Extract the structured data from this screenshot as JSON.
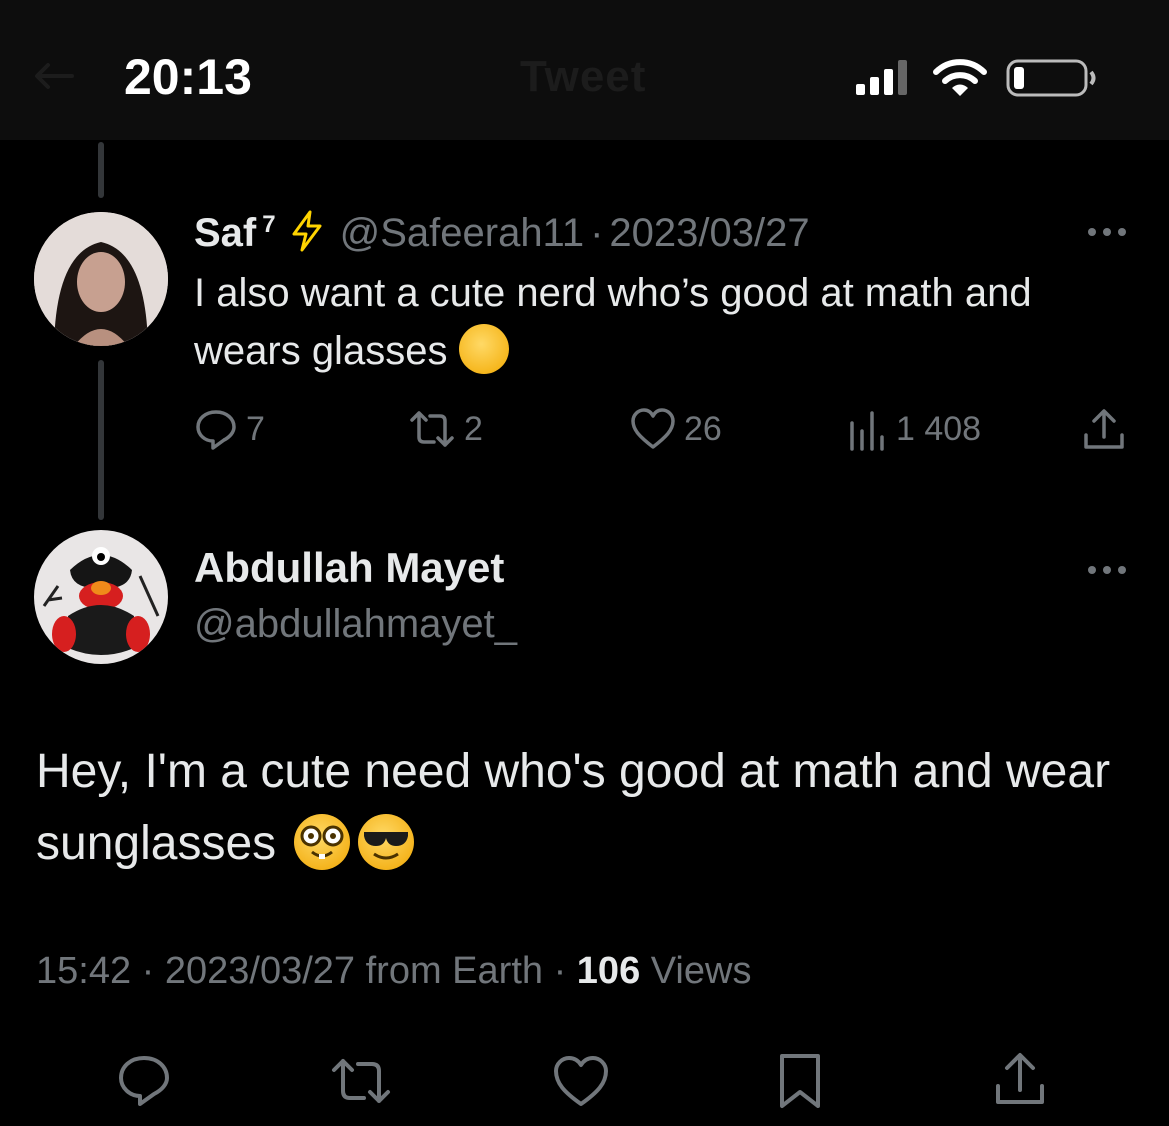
{
  "status_bar": {
    "time": "20:13",
    "header_title": "Tweet"
  },
  "parent_tweet": {
    "author_name": "Saf",
    "author_name_sup": "7",
    "author_handle": "@Safeerah11",
    "separator": "·",
    "date": "2023/03/27",
    "text": "I also want a cute nerd who’s good at math and wears glasses",
    "emoji_icon": "hand-over-mouth-emoji",
    "replies": "7",
    "retweets": "2",
    "likes": "26",
    "views": "1 408"
  },
  "main_tweet": {
    "author_name": "Abdullah Mayet",
    "author_handle": "@abdullahmayet_",
    "text": "Hey, I'm a cute need who's good at math and wear sunglasses",
    "emoji_icons": [
      "nerd-face-emoji",
      "sunglasses-face-emoji"
    ],
    "time": "15:42",
    "separator": "·",
    "date": "2023/03/27",
    "source": "from Earth",
    "views_count": "106",
    "views_label": "Views"
  },
  "colors": {
    "background": "#000000",
    "text_primary": "#e7e9ea",
    "text_secondary": "#71767b",
    "accent_bolt": "#ffd400"
  }
}
